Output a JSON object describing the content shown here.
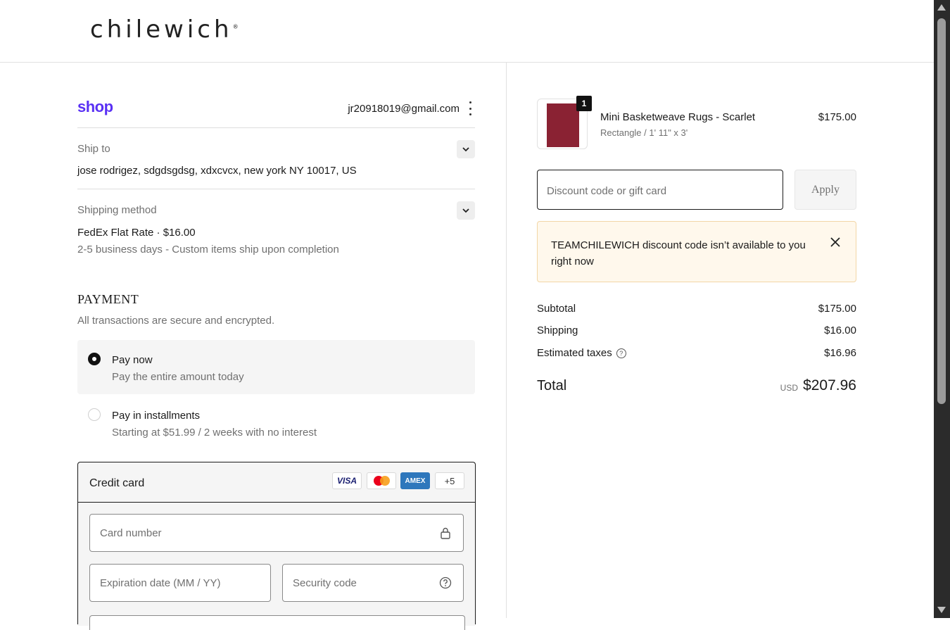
{
  "brand": {
    "logo": "chilewich",
    "logo_mark": "®"
  },
  "account": {
    "shop_logo": "shop",
    "email": "jr20918019@gmail.com"
  },
  "ship_to": {
    "label": "Ship to",
    "value": "jose rodrigez, sdgdsgdsg, xdxcvcx, new york NY 10017, US"
  },
  "shipping_method": {
    "label": "Shipping method",
    "value": "FedEx Flat Rate · $16.00",
    "note": "2-5 business days - Custom items ship upon completion"
  },
  "payment": {
    "title": "PAYMENT",
    "subtitle": "All transactions are secure and encrypted.",
    "options": [
      {
        "title": "Pay now",
        "sub": "Pay the entire amount today",
        "selected": true
      },
      {
        "title": "Pay in installments",
        "sub": "Starting at $51.99 / 2 weeks with no interest",
        "selected": false
      }
    ],
    "credit_card": {
      "title": "Credit card",
      "logos": [
        "VISA",
        "",
        "AMEX",
        "+5"
      ],
      "card_number_placeholder": "Card number",
      "expiration_placeholder": "Expiration date (MM / YY)",
      "security_placeholder": "Security code"
    }
  },
  "order": {
    "item": {
      "name": "Mini Basketweave Rugs - Scarlet",
      "variant": "Rectangle / 1' 11\" x 3'",
      "price": "$175.00",
      "quantity": "1",
      "color": "#8a2233"
    },
    "discount_placeholder": "Discount code or gift card",
    "apply_label": "Apply",
    "notice": "TEAMCHILEWICH discount code isn’t available to you right now",
    "summary": [
      {
        "label": "Subtotal",
        "value": "$175.00"
      },
      {
        "label": "Shipping",
        "value": "$16.00"
      },
      {
        "label": "Estimated taxes",
        "value": "$16.96"
      }
    ],
    "total_label": "Total",
    "total_currency": "USD",
    "total_value": "$207.96"
  }
}
